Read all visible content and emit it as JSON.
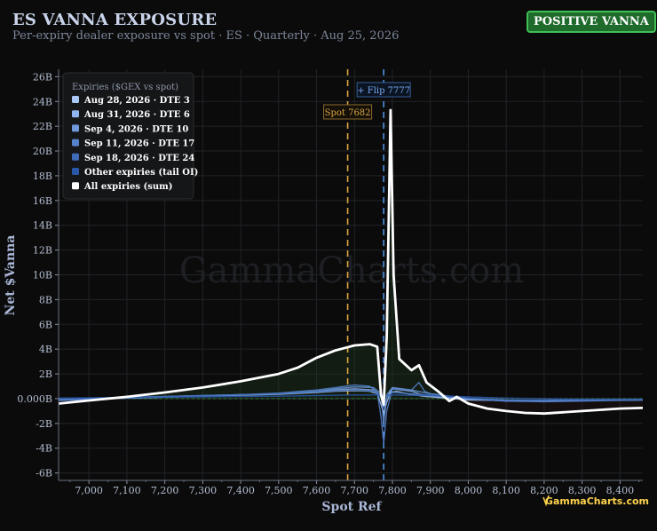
{
  "header": {
    "title": "ES VANNA EXPOSURE",
    "subtitle": "Per-expiry dealer exposure vs spot · ES · Quarterly · Aug 25, 2026",
    "badge": "POSITIVE VANNA"
  },
  "watermark": "GammaCharts.com",
  "brand": "GammaCharts.com",
  "chart_data": {
    "type": "line",
    "xlabel": "Spot Ref",
    "ylabel": "Net $Vanna",
    "xlim": [
      6920,
      8460
    ],
    "ylim": [
      -6.6,
      26.6
    ],
    "x_ticks": [
      7000,
      7100,
      7200,
      7300,
      7400,
      7500,
      7600,
      7700,
      7800,
      7900,
      8000,
      8100,
      8200,
      8300,
      8400
    ],
    "x_tick_labels": [
      "7,000",
      "7,100",
      "7,200",
      "7,300",
      "7,400",
      "7,500",
      "7,600",
      "7,700",
      "7,800",
      "7,900",
      "8,000",
      "8,100",
      "8,200",
      "8,300",
      "8,400"
    ],
    "y_ticks": [
      -6,
      -4,
      -2,
      0,
      2,
      4,
      6,
      8,
      10,
      12,
      14,
      16,
      18,
      20,
      22,
      24,
      26
    ],
    "y_tick_labels": [
      "-6B",
      "-4B",
      "-2B",
      "0.000B",
      "2B",
      "4B",
      "6B",
      "8B",
      "10B",
      "12B",
      "14B",
      "16B",
      "18B",
      "20B",
      "22B",
      "24B",
      "26B"
    ],
    "grid": true,
    "legend": {
      "title": "Expiries ($GEX vs spot)",
      "placement": "top-left"
    },
    "spot": {
      "value": 7682,
      "label": "Spot 7682",
      "color": "#d9a441"
    },
    "flip": {
      "value": 7777,
      "label": "+ Flip 7777",
      "color": "#4f8fe0"
    },
    "series": [
      {
        "name": "Aug 28, 2026 · DTE 3",
        "color": "#a9c8f5",
        "x": [
          6920,
          7100,
          7300,
          7500,
          7600,
          7650,
          7700,
          7740,
          7760,
          7770,
          7777,
          7785,
          7795,
          7810,
          7840,
          7880,
          7940,
          8000,
          8100,
          8200,
          8300,
          8460
        ],
        "y": [
          -0.1,
          0.05,
          0.2,
          0.35,
          0.5,
          0.6,
          0.65,
          0.6,
          0.4,
          -0.5,
          -1.2,
          -0.3,
          0.5,
          0.6,
          0.4,
          0.2,
          0.05,
          -0.1,
          -0.15,
          -0.15,
          -0.1,
          -0.1
        ]
      },
      {
        "name": "Aug 31, 2026 · DTE 6",
        "color": "#8fb3ee",
        "x": [
          6920,
          7100,
          7300,
          7500,
          7600,
          7650,
          7700,
          7750,
          7770,
          7777,
          7785,
          7800,
          7850,
          7880,
          7940,
          8000,
          8100,
          8200,
          8300,
          8460
        ],
        "y": [
          -0.05,
          0.1,
          0.25,
          0.4,
          0.55,
          0.7,
          0.8,
          0.7,
          0.2,
          -0.6,
          0.1,
          0.8,
          0.6,
          0.3,
          0.1,
          -0.05,
          -0.15,
          -0.2,
          -0.15,
          -0.1
        ]
      },
      {
        "name": "Sep 4, 2026 · DTE 10",
        "color": "#6f99dc",
        "x": [
          6920,
          7100,
          7300,
          7500,
          7600,
          7650,
          7700,
          7750,
          7770,
          7777,
          7785,
          7800,
          7850,
          7900,
          7950,
          8000,
          8100,
          8200,
          8300,
          8460
        ],
        "y": [
          -0.1,
          0.05,
          0.2,
          0.4,
          0.6,
          0.8,
          0.95,
          0.9,
          0.4,
          -2.0,
          0.3,
          0.9,
          0.7,
          0.4,
          0.2,
          0.0,
          -0.2,
          -0.2,
          -0.15,
          -0.1
        ]
      },
      {
        "name": "Sep 11, 2026 · DTE 17",
        "color": "#5682cc",
        "x": [
          6920,
          7100,
          7300,
          7500,
          7600,
          7650,
          7700,
          7740,
          7760,
          7770,
          7777,
          7785,
          7800,
          7850,
          7870,
          7885,
          7900,
          7950,
          8000,
          8100,
          8200,
          8300,
          8460
        ],
        "y": [
          -0.15,
          0.05,
          0.2,
          0.45,
          0.7,
          0.9,
          1.1,
          1.0,
          0.5,
          -1.5,
          -3.6,
          -1.0,
          0.8,
          0.7,
          1.3,
          0.6,
          0.4,
          0.2,
          0.0,
          -0.2,
          -0.25,
          -0.2,
          -0.1
        ]
      },
      {
        "name": "Sep 18, 2026 · DTE 24",
        "color": "#3f6cb8",
        "x": [
          6920,
          7100,
          7300,
          7500,
          7600,
          7650,
          7700,
          7750,
          7770,
          7777,
          7785,
          7800,
          7850,
          7900,
          7950,
          8000,
          8100,
          8200,
          8300,
          8460
        ],
        "y": [
          -0.05,
          0.1,
          0.25,
          0.4,
          0.55,
          0.65,
          0.7,
          0.6,
          0.1,
          -0.8,
          0.1,
          0.5,
          0.4,
          0.3,
          0.15,
          0.05,
          -0.1,
          -0.15,
          -0.1,
          -0.05
        ]
      },
      {
        "name": "Other expiries (tail OI)",
        "color": "#2a58a8",
        "x": [
          6920,
          7100,
          7300,
          7500,
          7600,
          7700,
          7800,
          7900,
          8000,
          8100,
          8200,
          8300,
          8460
        ],
        "y": [
          0.05,
          0.1,
          0.15,
          0.2,
          0.25,
          0.3,
          0.3,
          0.25,
          0.15,
          0.05,
          0.0,
          -0.05,
          -0.05
        ]
      },
      {
        "name": "All expiries (sum)",
        "color": "#ffffff",
        "x": [
          6920,
          7000,
          7100,
          7200,
          7300,
          7400,
          7500,
          7550,
          7600,
          7650,
          7700,
          7740,
          7760,
          7770,
          7777,
          7785,
          7795,
          7803,
          7818,
          7850,
          7870,
          7890,
          7920,
          7950,
          7970,
          8000,
          8050,
          8100,
          8150,
          8200,
          8250,
          8300,
          8350,
          8400,
          8460
        ],
        "y": [
          -0.4,
          -0.15,
          0.15,
          0.5,
          0.9,
          1.4,
          2.0,
          2.5,
          3.3,
          3.9,
          4.3,
          4.4,
          4.2,
          0.3,
          -0.5,
          5.0,
          23.3,
          10.0,
          3.2,
          2.3,
          2.7,
          1.3,
          0.6,
          -0.2,
          0.15,
          -0.4,
          -0.8,
          -1.0,
          -1.15,
          -1.2,
          -1.1,
          -1.0,
          -0.9,
          -0.8,
          -0.75
        ]
      }
    ]
  }
}
